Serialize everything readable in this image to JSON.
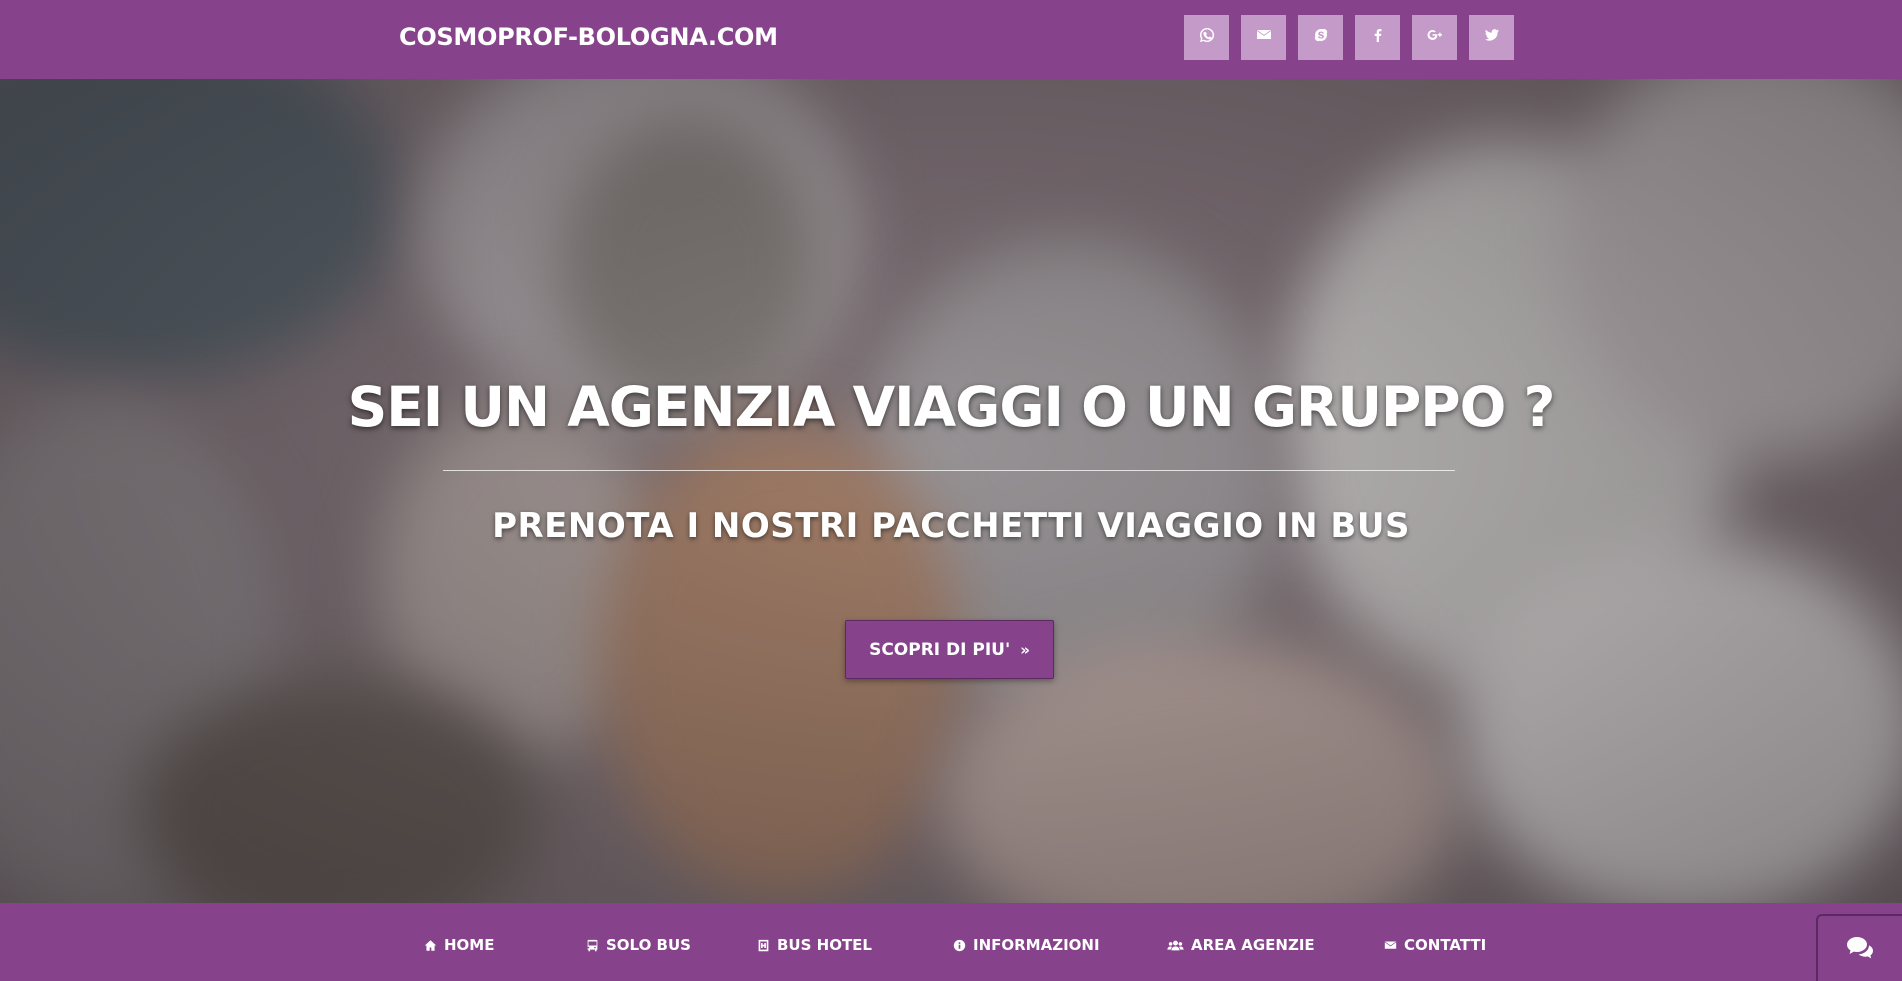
{
  "brand": "COSMOPROF-BOLOGNA.COM",
  "colors": {
    "primary": "#86438c",
    "social_button": "#c49ac9"
  },
  "social": [
    {
      "icon": "whatsapp-icon"
    },
    {
      "icon": "envelope-icon"
    },
    {
      "icon": "skype-icon"
    },
    {
      "icon": "facebook-icon"
    },
    {
      "icon": "google-plus-icon"
    },
    {
      "icon": "twitter-icon"
    }
  ],
  "hero": {
    "headline": "SEI UN AGENZIA VIAGGI O UN GRUPPO ?",
    "subheadline": "PRENOTA I NOSTRI PACCHETTI VIAGGIO IN BUS",
    "cta_label": "SCOPRI DI PIU'"
  },
  "nav": [
    {
      "label": "HOME",
      "icon": "home-icon"
    },
    {
      "label": "SOLO BUS",
      "icon": "bus-icon"
    },
    {
      "label": "BUS HOTEL",
      "icon": "hotel-icon"
    },
    {
      "label": "INFORMAZIONI",
      "icon": "info-icon"
    },
    {
      "label": "AREA AGENZIE",
      "icon": "users-icon"
    },
    {
      "label": "CONTATTI",
      "icon": "envelope-icon"
    }
  ],
  "chat": {
    "icon": "chat-icon"
  }
}
